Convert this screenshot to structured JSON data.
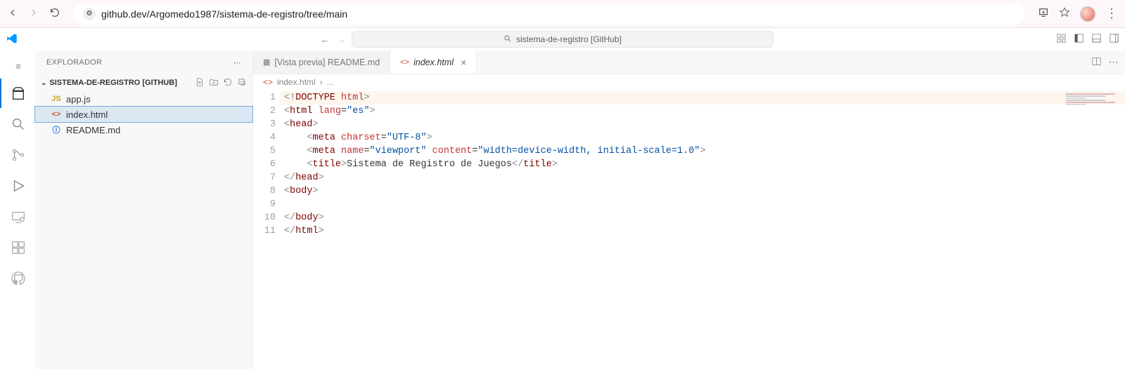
{
  "browser": {
    "url": "github.dev/Argomedo1987/sistema-de-registro/tree/main"
  },
  "titlebar": {
    "command_center": "sistema-de-registro [GitHub]"
  },
  "sidebar": {
    "title": "EXPLORADOR",
    "project": "SISTEMA-DE-REGISTRO [GITHUB]",
    "files": [
      {
        "icon": "JS",
        "iconClass": "ic-js",
        "name": "app.js"
      },
      {
        "icon": "<>",
        "iconClass": "ic-html",
        "name": "index.html"
      },
      {
        "icon": "ⓘ",
        "iconClass": "ic-info",
        "name": "README.md"
      }
    ]
  },
  "tabs": [
    {
      "icon": "▦",
      "iconClass": "",
      "label": "[Vista previa] README.md",
      "active": false,
      "italic": false,
      "closeable": false
    },
    {
      "icon": "<>",
      "iconClass": "ic-html",
      "label": "index.html",
      "active": true,
      "italic": true,
      "closeable": true
    }
  ],
  "breadcrumbs": {
    "icon": "<>",
    "file": "index.html",
    "sep": "›",
    "tail": "..."
  },
  "code": {
    "lines": [
      {
        "n": 1,
        "html": "<span class='tk-ang'>&lt;!</span><span class='tk-tag'>DOCTYPE</span> <span class='tk-attr'>html</span><span class='tk-ang'>&gt;</span>",
        "hl": true
      },
      {
        "n": 2,
        "html": "<span class='tk-ang'>&lt;</span><span class='tk-tag'>html</span> <span class='tk-attr'>lang</span>=<span class='tk-str'>\"es\"</span><span class='tk-ang'>&gt;</span>"
      },
      {
        "n": 3,
        "html": "<span class='tk-ang'>&lt;</span><span class='tk-tag'>head</span><span class='tk-ang'>&gt;</span>"
      },
      {
        "n": 4,
        "html": "    <span class='tk-ang'>&lt;</span><span class='tk-tag'>meta</span> <span class='tk-attr'>charset</span>=<span class='tk-str'>\"UTF-8\"</span><span class='tk-ang'>&gt;</span>"
      },
      {
        "n": 5,
        "html": "    <span class='tk-ang'>&lt;</span><span class='tk-tag'>meta</span> <span class='tk-attr'>name</span>=<span class='tk-str'>\"viewport\"</span> <span class='tk-attr'>content</span>=<span class='tk-str'>\"width=device-width, initial-scale=1.0\"</span><span class='tk-ang'>&gt;</span>"
      },
      {
        "n": 6,
        "html": "    <span class='tk-ang'>&lt;</span><span class='tk-tag'>title</span><span class='tk-ang'>&gt;</span>Sistema de Registro de Juegos<span class='tk-ang'>&lt;/</span><span class='tk-tag'>title</span><span class='tk-ang'>&gt;</span>"
      },
      {
        "n": 7,
        "html": "<span class='tk-ang'>&lt;/</span><span class='tk-tag'>head</span><span class='tk-ang'>&gt;</span>"
      },
      {
        "n": 8,
        "html": "<span class='tk-ang'>&lt;</span><span class='tk-tag'>body</span><span class='tk-ang'>&gt;</span>"
      },
      {
        "n": 9,
        "html": ""
      },
      {
        "n": 10,
        "html": "<span class='tk-ang'>&lt;/</span><span class='tk-tag'>body</span><span class='tk-ang'>&gt;</span>"
      },
      {
        "n": 11,
        "html": "<span class='tk-ang'>&lt;/</span><span class='tk-tag'>html</span><span class='tk-ang'>&gt;</span>"
      }
    ]
  }
}
